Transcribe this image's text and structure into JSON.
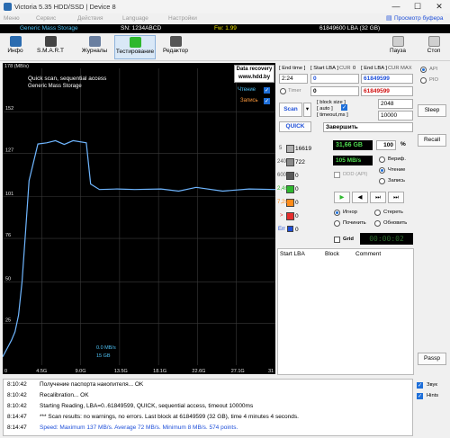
{
  "window": {
    "title": "Victoria 5.35 HDD/SSD | Device 8",
    "min": "—",
    "max": "☐",
    "close": "✕"
  },
  "menu": {
    "items": [
      "Меню",
      "Сервис",
      "Действия",
      "Language",
      "Настройки"
    ],
    "right": "Просмотр буфера"
  },
  "infobar": {
    "model": "Generic Mass Storage",
    "serial": "SN: 1234ABCD",
    "fw": "Fw: 1.99",
    "lba": "61849600 LBA (32 GB)"
  },
  "toolbar": {
    "items": [
      "Инфо",
      "S.M.A.R.T",
      "Журналы",
      "Тестирование",
      "Редактор"
    ],
    "pause": "Пауза",
    "stop": "Стоп"
  },
  "graph": {
    "header1": "Quick scan, sequential access",
    "header2": "Generic Mass Storage",
    "datarecovery": "Data recovery",
    "site": "www.hdd.by",
    "read_label": "Чтение",
    "write_label": "Запись",
    "cursor_speed": "0.0 MB/s",
    "cursor_pos": "15 GB",
    "ytick_top": "178 (MB/s)"
  },
  "chart_data": {
    "type": "line",
    "yticks": [
      "152",
      "127",
      "101",
      "76",
      "50",
      "25"
    ],
    "xticks": [
      "0",
      "4.5G",
      "9.0G",
      "13.5G",
      "18.1G",
      "22.6G",
      "27.1G",
      "31"
    ],
    "ylim": [
      0,
      178
    ],
    "series": [
      {
        "name": "Чтение",
        "x_gb": [
          0,
          0.5,
          1.0,
          1.4,
          1.8,
          2.2,
          2.6,
          3.0,
          3.4,
          4.0,
          5.0,
          6.0,
          7.0,
          8.0,
          9.5,
          10.0,
          11,
          13,
          15,
          18,
          20,
          22,
          25,
          28,
          31
        ],
        "y": [
          5,
          10,
          15,
          20,
          30,
          50,
          80,
          110,
          120,
          132,
          134,
          134,
          133,
          134,
          134,
          108,
          106,
          105,
          106,
          105,
          105,
          106,
          105,
          105,
          106
        ]
      }
    ]
  },
  "controls": {
    "end_time_label": "[ End time ]",
    "start_lba_label": "[ Start LBA ]",
    "cur_label": "CUR",
    "zero": "0",
    "end_lba_label": "[ End LBA ]",
    "max_label": "MAX",
    "time_value": "2:24",
    "start_lba_value": "0",
    "end_lba_value": "61849599",
    "timer_label": "Timer",
    "timer_value": "0",
    "end_lba_value2": "61849599",
    "scan_label": "Scan",
    "block_size_label": "[ block size ]",
    "auto_label": "[ auto ]",
    "block_size_value": "2048",
    "timeout_label": "[ timeout,ms ]",
    "timeout_value": "10000",
    "quick_label": "QUICK",
    "finish_value": "Завершить",
    "api_label": "API",
    "pio_label": "PIO",
    "sleep_label": "Sleep",
    "recall_label": "Recall",
    "passp_label": "Passp"
  },
  "stats": {
    "blocks": [
      {
        "label": "5",
        "count": "16619",
        "color": "#b0b0b0"
      },
      {
        "label": "240",
        "count": "722",
        "color": "#8a8a8a"
      },
      {
        "label": "600",
        "count": "0",
        "color": "#5a5a5a"
      },
      {
        "label": "2,4s",
        "count": "0",
        "color": "#2eb82e"
      },
      {
        "label": "7,2s",
        "count": "0",
        "color": "#ff8c1a"
      },
      {
        "label": ">",
        "count": "0",
        "color": "#e62e2e"
      },
      {
        "label": "Err",
        "count": "0",
        "color": "#1e4fd9"
      }
    ],
    "gb_read": "31,66 GB",
    "percent": "100",
    "percent_unit": "%",
    "speed": "105 MB/s",
    "verify": "Вериф.",
    "read": "Чтение",
    "write": "Запись",
    "ddd": "DDD (API)",
    "ignore": "Игнор",
    "erase": "Стереть",
    "remap": "Починить",
    "refresh": "Обновить",
    "grid": "Grid",
    "timer_display": "00:00:02"
  },
  "table": {
    "headers": [
      "Start LBA",
      "Block",
      "Comment"
    ]
  },
  "log": {
    "rows": [
      {
        "time": "8:10:42",
        "msg": "Получение паспорта накопителя... OK",
        "color": "#000"
      },
      {
        "time": "8:10:42",
        "msg": "Recalibration... OK",
        "color": "#000"
      },
      {
        "time": "8:10:42",
        "msg": "Starting Reading, LBA=0..61849599, QUICK, sequential access, timeout 10000ms",
        "color": "#000"
      },
      {
        "time": "8:14:47",
        "msg": "*** Scan results: no warnings, no errors. Last block at 61849599 (32 GB), time 4 minutes 4 seconds.",
        "color": "#000"
      },
      {
        "time": "8:14:47",
        "msg": "Speed: Maximum 137 MB/s. Average 72 MB/s. Minimum 8 MB/s. 574 points.",
        "color": "#1e4fd9"
      }
    ],
    "sound": "Звук",
    "hints": "Hints"
  }
}
